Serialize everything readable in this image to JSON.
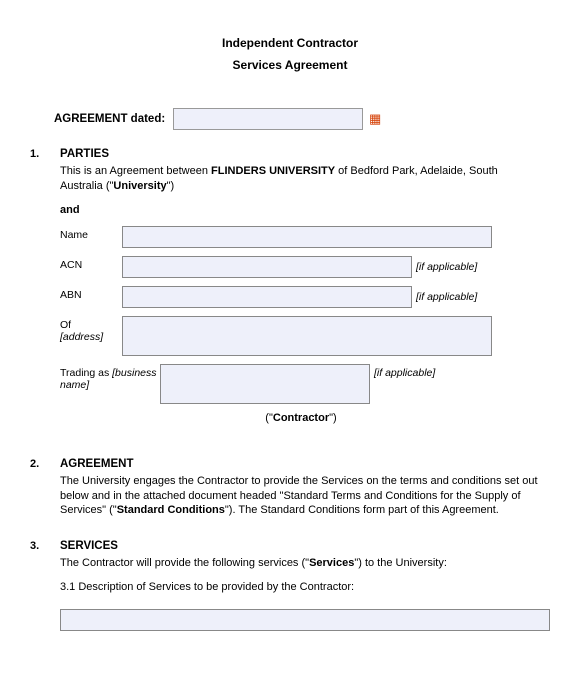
{
  "title1": "Independent Contractor",
  "title2": "Services Agreement",
  "dated_label": "AGREEMENT dated:",
  "sections": {
    "s1": {
      "num": "1.",
      "head": "PARTIES",
      "intro_a": "This is an Agreement between ",
      "intro_b": "FLINDERS UNIVERSITY",
      "intro_c": " of Bedford Park, Adelaide, South Australia (\"",
      "intro_d": "University",
      "intro_e": "\")",
      "and": "and",
      "name_label": "Name",
      "acn_label": "ACN",
      "abn_label": "ABN",
      "if_applicable": "[if applicable]",
      "of_label": "Of",
      "of_hint": "[address]",
      "trading_label": "Trading as ",
      "trading_hint": "[business name]",
      "contractor_a": "(\"",
      "contractor_b": "Contractor",
      "contractor_c": "\")"
    },
    "s2": {
      "num": "2.",
      "head": "AGREEMENT",
      "text_a": "The University engages the Contractor to provide the Services on the terms and conditions set out below and in the attached document headed \"Standard Terms and Conditions for the Supply of Services\" (\"",
      "text_b": "Standard Conditions",
      "text_c": "\").  The Standard Conditions form part of this Agreement."
    },
    "s3": {
      "num": "3.",
      "head": "SERVICES",
      "text_a": "The Contractor will provide the following services (\"",
      "text_b": "Services",
      "text_c": "\") to the University:",
      "sub": "3.1  Description of Services to be provided by the Contractor:"
    }
  }
}
